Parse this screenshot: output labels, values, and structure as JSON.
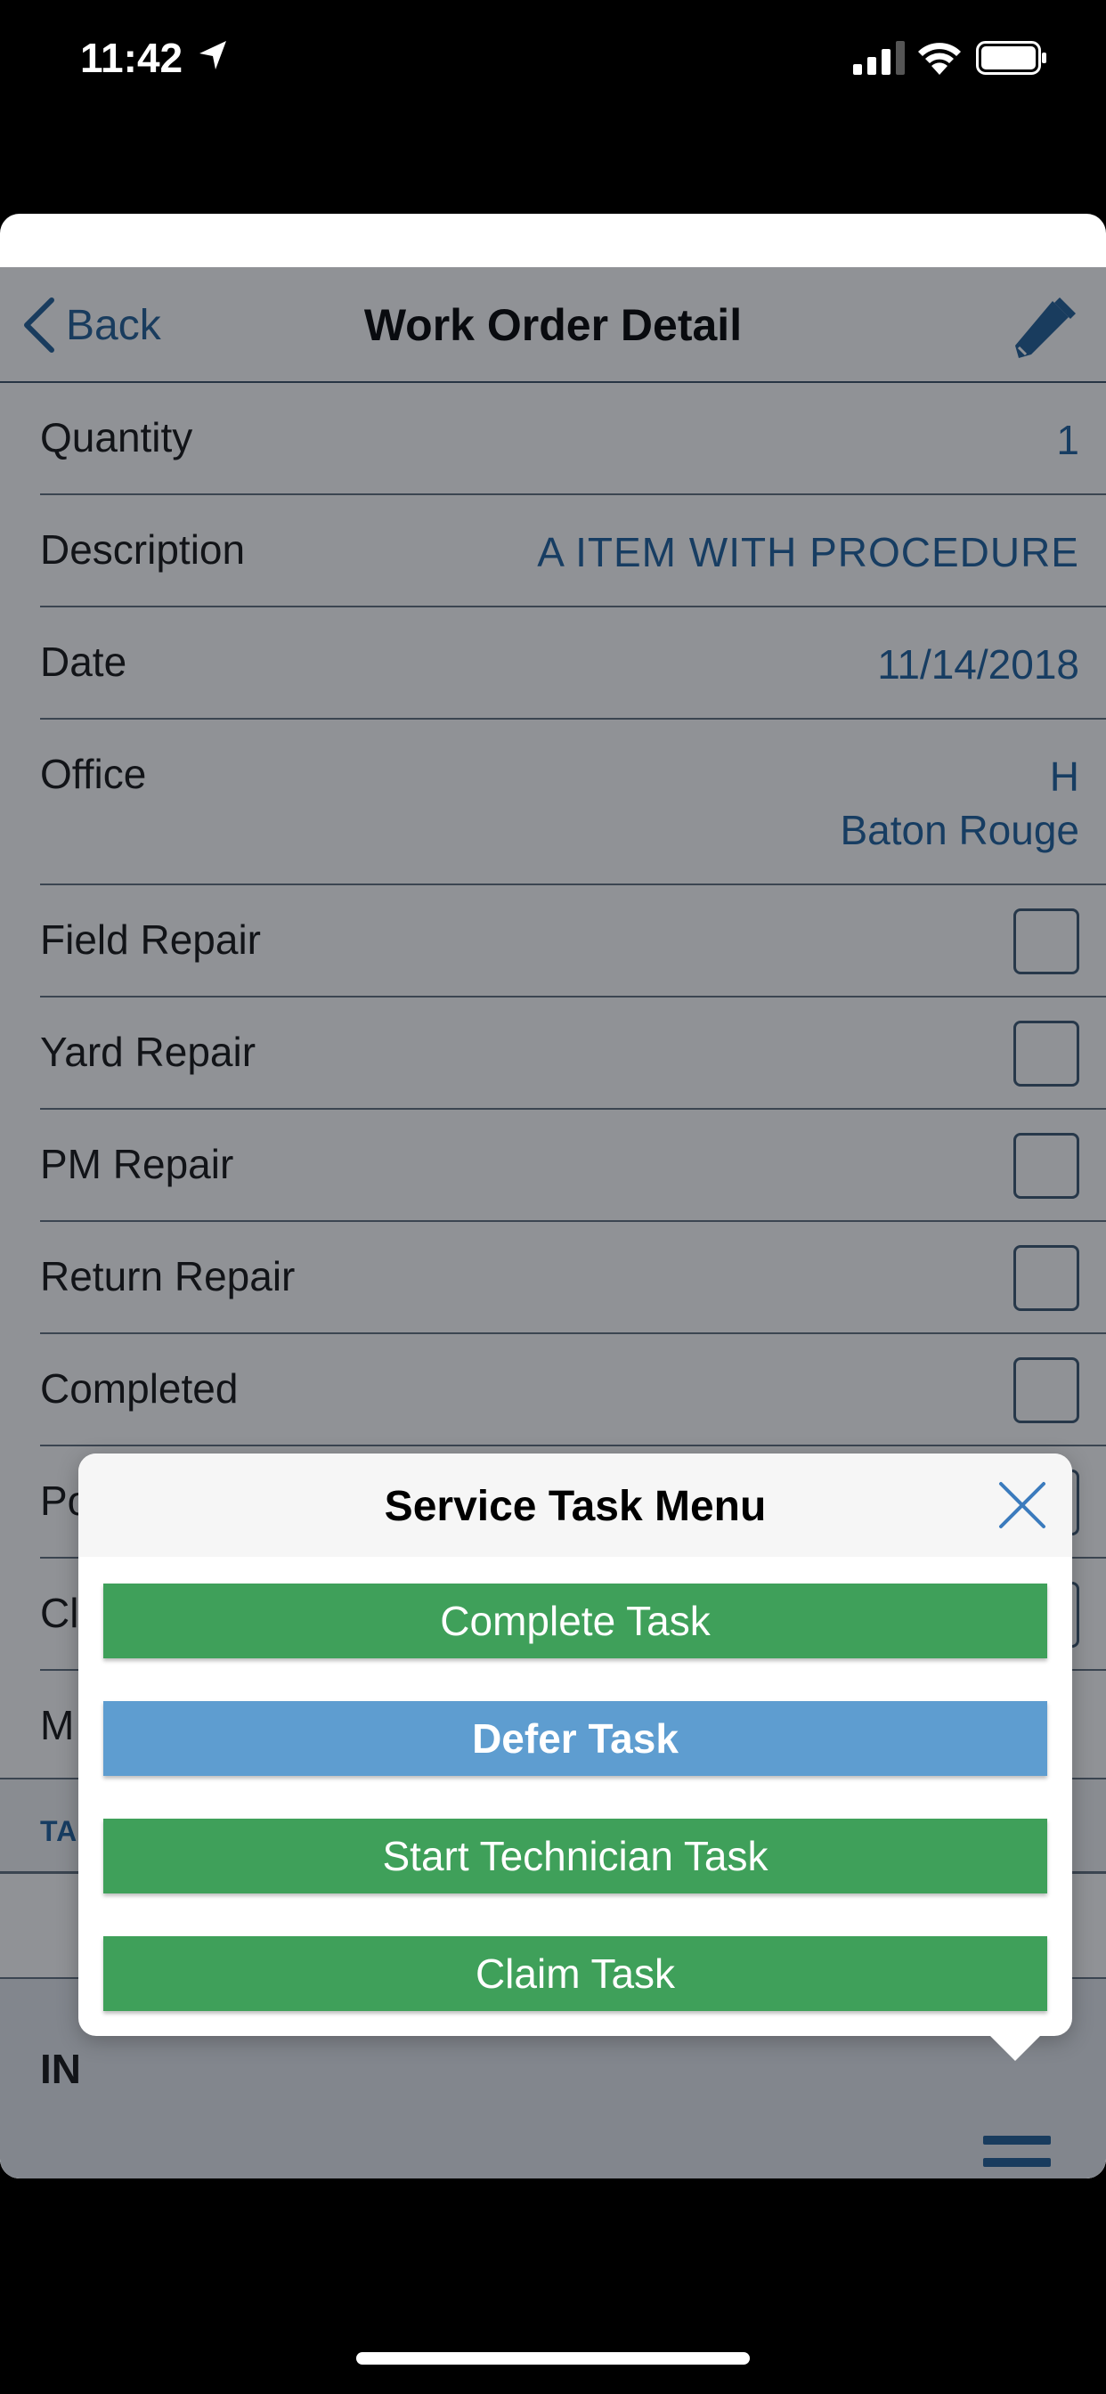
{
  "status_bar": {
    "time": "11:42",
    "icons": [
      "location-arrow-icon",
      "signal-icon",
      "wifi-icon",
      "battery-icon"
    ]
  },
  "nav": {
    "back_label": "Back",
    "title": "Work Order Detail",
    "edit_icon": "pencil-icon"
  },
  "fields": [
    {
      "label": "Quantity",
      "value": "1"
    },
    {
      "label": "Description",
      "value": "A ITEM WITH PROCEDURE"
    },
    {
      "label": "Date",
      "value": "11/14/2018"
    },
    {
      "label": "Office",
      "value_line1": "H",
      "value_line2": "Baton Rouge"
    }
  ],
  "checkboxes": [
    {
      "label": "Field Repair",
      "checked": false
    },
    {
      "label": "Yard Repair",
      "checked": false
    },
    {
      "label": "PM Repair",
      "checked": false
    },
    {
      "label": "Return Repair",
      "checked": false
    },
    {
      "label": "Completed",
      "checked": false
    }
  ],
  "partial_rows": [
    "Po",
    "Cl",
    "M"
  ],
  "section_tag": "TA",
  "bottom_label": "IN",
  "popup": {
    "title": "Service Task Menu",
    "close_icon": "close-icon",
    "buttons": [
      {
        "label": "Complete Task",
        "color": "#3fa05a"
      },
      {
        "label": "Defer Task",
        "color": "#5e9dd0"
      },
      {
        "label": "Start Technician Task",
        "color": "#3fa05a"
      },
      {
        "label": "Claim Task",
        "color": "#3fa05a"
      }
    ]
  },
  "colors": {
    "accent": "#1c5f9e",
    "green": "#3fa05a",
    "blue": "#5e9dd0"
  }
}
